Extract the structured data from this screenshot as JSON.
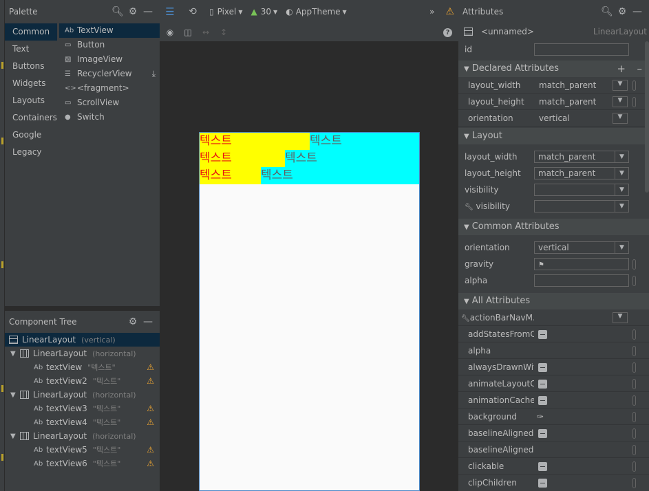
{
  "palette": {
    "title": "Palette",
    "categories": [
      "Common",
      "Text",
      "Buttons",
      "Widgets",
      "Layouts",
      "Containers",
      "Google",
      "Legacy"
    ],
    "components": [
      {
        "icon": "Ab",
        "label": "TextView"
      },
      {
        "icon": "▭",
        "label": "Button"
      },
      {
        "icon": "▨",
        "label": "ImageView"
      },
      {
        "icon": "☰",
        "label": "RecyclerView"
      },
      {
        "icon": "<>",
        "label": "<fragment>"
      },
      {
        "icon": "▭",
        "label": "ScrollView"
      },
      {
        "icon": "●",
        "label": "Switch"
      }
    ]
  },
  "tree": {
    "title": "Component Tree",
    "rows": [
      {
        "name": "LinearLayout",
        "hint": "(vertical)"
      },
      {
        "name": "LinearLayout",
        "hint": "(horizontal)"
      },
      {
        "name": "textView",
        "hint": "\"텍스트\""
      },
      {
        "name": "textView2",
        "hint": "\"텍스트\""
      },
      {
        "name": "LinearLayout",
        "hint": "(horizontal)"
      },
      {
        "name": "textView3",
        "hint": "\"텍스트\""
      },
      {
        "name": "textView4",
        "hint": "\"텍스트\""
      },
      {
        "name": "LinearLayout",
        "hint": "(horizontal)"
      },
      {
        "name": "textView5",
        "hint": "\"텍스트\""
      },
      {
        "name": "textView6",
        "hint": "\"텍스트\""
      }
    ]
  },
  "toolbar": {
    "device": "Pixel",
    "api": "30",
    "theme": "AppTheme",
    "chevrons": "»"
  },
  "preview": {
    "text": "텍스트"
  },
  "attributes": {
    "title": "Attributes",
    "component": "<unnamed>",
    "component_type": "LinearLayout",
    "id_label": "id",
    "sections": {
      "declared": "Declared Attributes",
      "layout": "Layout",
      "common": "Common Attributes",
      "all": "All Attributes"
    },
    "declared": [
      {
        "label": "layout_width",
        "value": "match_parent"
      },
      {
        "label": "layout_height",
        "value": "match_parent"
      },
      {
        "label": "orientation",
        "value": "vertical"
      }
    ],
    "layout": [
      {
        "label": "layout_width",
        "value": "match_parent"
      },
      {
        "label": "layout_height",
        "value": "match_parent"
      },
      {
        "label": "visibility",
        "value": ""
      },
      {
        "label": "visibility",
        "value": ""
      }
    ],
    "common": [
      {
        "label": "orientation",
        "value": "vertical"
      },
      {
        "label": "gravity",
        "value": ""
      },
      {
        "label": "alpha",
        "value": ""
      }
    ],
    "all": [
      "actionBarNavM...",
      "addStatesFromC...",
      "alpha",
      "alwaysDrawnWit...",
      "animateLayoutC...",
      "animationCache",
      "background",
      "baselineAligned",
      "baselineAligned...",
      "clickable",
      "clipChildren"
    ]
  }
}
